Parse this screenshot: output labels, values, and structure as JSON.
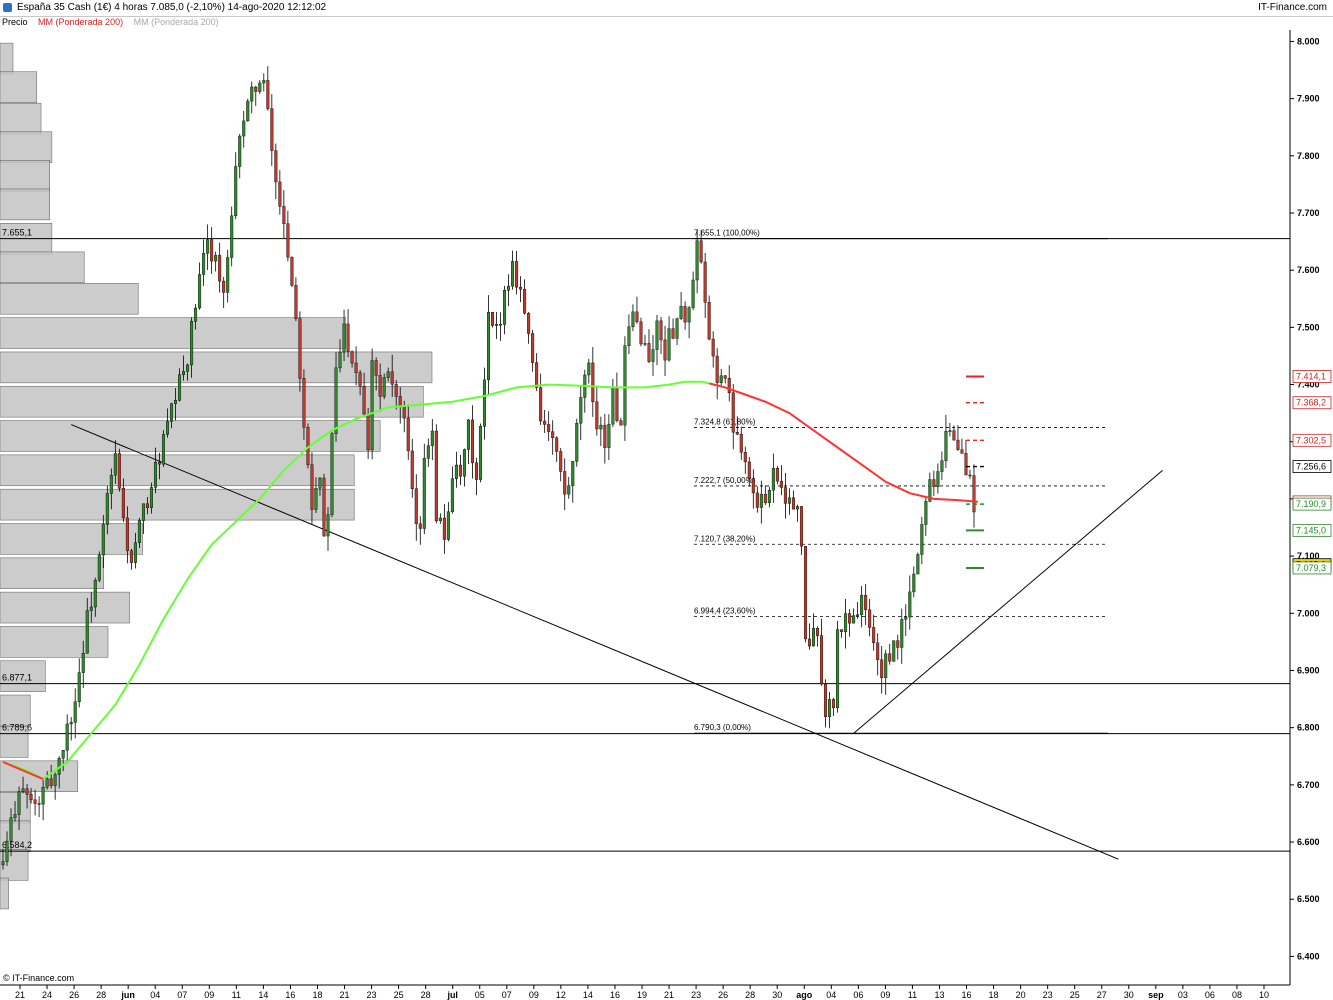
{
  "header": {
    "title": "España 35 Cash (1€)   4 horas   7.085,0 (-2,10%)   14-ago-2020 12:12:02",
    "brand": "IT-Finance.com"
  },
  "legend": {
    "price": "Precio",
    "ma": "MM (Ponderada 200)",
    "extra": "MM (Ponderada 200)"
  },
  "copyright": "© IT-Finance.com",
  "colors": {
    "ma": "#ff3333",
    "ma_green": "#66ff33",
    "up": "#2d8a2d",
    "down": "#c0392b",
    "profile": "#c4c4c4",
    "current": "#f5d000"
  },
  "chart_data": {
    "type": "candlestick",
    "ylim": [
      6350,
      8020
    ],
    "y_ticks": [
      "6.400",
      "6.500",
      "6.600",
      "6.700",
      "6.800",
      "6.900",
      "7.000",
      "7.100",
      "7.200",
      "7.300",
      "7.400",
      "7.500",
      "7.600",
      "7.700",
      "7.800",
      "7.900",
      "8.000"
    ],
    "x_ticks": [
      {
        "label": "21"
      },
      {
        "label": "24"
      },
      {
        "label": "26"
      },
      {
        "label": "28"
      },
      {
        "label": "jun",
        "bold": true
      },
      {
        "label": "04"
      },
      {
        "label": "07"
      },
      {
        "label": "09"
      },
      {
        "label": "11"
      },
      {
        "label": "14"
      },
      {
        "label": "16"
      },
      {
        "label": "18"
      },
      {
        "label": "21"
      },
      {
        "label": "23"
      },
      {
        "label": "25"
      },
      {
        "label": "28"
      },
      {
        "label": "jul",
        "bold": true
      },
      {
        "label": "05"
      },
      {
        "label": "07"
      },
      {
        "label": "09"
      },
      {
        "label": "12"
      },
      {
        "label": "14"
      },
      {
        "label": "16"
      },
      {
        "label": "19"
      },
      {
        "label": "21"
      },
      {
        "label": "23"
      },
      {
        "label": "26"
      },
      {
        "label": "28"
      },
      {
        "label": "30"
      },
      {
        "label": "ago",
        "bold": true
      },
      {
        "label": "04"
      },
      {
        "label": "06"
      },
      {
        "label": "09"
      },
      {
        "label": "11"
      },
      {
        "label": "13"
      },
      {
        "label": "16"
      },
      {
        "label": "18"
      },
      {
        "label": "20"
      },
      {
        "label": "23"
      },
      {
        "label": "25"
      },
      {
        "label": "27"
      },
      {
        "label": "30"
      },
      {
        "label": "sep",
        "bold": true
      },
      {
        "label": "03"
      },
      {
        "label": "06"
      },
      {
        "label": "08"
      },
      {
        "label": "10"
      }
    ],
    "horizontal_levels": [
      {
        "value": 7655.1,
        "label": "7.655,1"
      },
      {
        "value": 6877.1,
        "label": "6.877,1"
      },
      {
        "value": 6789.6,
        "label": "6.789,6"
      },
      {
        "value": 6584.2,
        "label": "6.584,2"
      }
    ],
    "fibonacci": [
      {
        "value": 7655.1,
        "label": "7.655,1 (100,00%)",
        "solid": true
      },
      {
        "value": 7324.8,
        "label": "7.324,8 (61,80%)"
      },
      {
        "value": 7222.7,
        "label": "7.222,7 (50,00%)"
      },
      {
        "value": 7120.7,
        "label": "7.120,7 (38,20%)"
      },
      {
        "value": 6994.4,
        "label": "6.994,4 (23,60%)"
      },
      {
        "value": 6790.3,
        "label": "6.790,3 (0,00%)",
        "solid": true
      }
    ],
    "price_labels": [
      {
        "value": 7414.1,
        "label": "7.414,1",
        "color": "#d22222"
      },
      {
        "value": 7368.2,
        "label": "7.368,2",
        "color": "#d22222"
      },
      {
        "value": 7302.5,
        "label": "7.302,5",
        "color": "#d22222"
      },
      {
        "value": 7256.6,
        "label": "7.256,6",
        "color": "#000000"
      },
      {
        "value": 7194.8,
        "label": "7.194,8",
        "color": "#d22222"
      },
      {
        "value": 7190.9,
        "label": "7.190,9",
        "color": "#2d8a2d"
      },
      {
        "value": 7145.0,
        "label": "7.145,0",
        "color": "#2d8a2d"
      },
      {
        "value": 7085.0,
        "label": "7.085,0",
        "color": "#000000",
        "current": true
      },
      {
        "value": 7079.3,
        "label": "7.079,3",
        "color": "#2d8a2d"
      }
    ],
    "volume_profile": [
      {
        "price": 7970,
        "size": 0.03
      },
      {
        "price": 7920,
        "size": 0.085
      },
      {
        "price": 7865,
        "size": 0.095
      },
      {
        "price": 7815,
        "size": 0.12
      },
      {
        "price": 7765,
        "size": 0.115
      },
      {
        "price": 7715,
        "size": 0.115
      },
      {
        "price": 7655,
        "size": 0.12
      },
      {
        "price": 7605,
        "size": 0.195
      },
      {
        "price": 7550,
        "size": 0.32
      },
      {
        "price": 7490,
        "size": 0.8
      },
      {
        "price": 7430,
        "size": 1.0
      },
      {
        "price": 7370,
        "size": 0.98
      },
      {
        "price": 7310,
        "size": 0.88
      },
      {
        "price": 7250,
        "size": 0.82
      },
      {
        "price": 7190,
        "size": 0.82
      },
      {
        "price": 7130,
        "size": 0.33
      },
      {
        "price": 7070,
        "size": 0.24
      },
      {
        "price": 7010,
        "size": 0.3
      },
      {
        "price": 6950,
        "size": 0.25
      },
      {
        "price": 6890,
        "size": 0.105
      },
      {
        "price": 6830,
        "size": 0.07
      },
      {
        "price": 6775,
        "size": 0.065
      },
      {
        "price": 6715,
        "size": 0.18
      },
      {
        "price": 6660,
        "size": 0.07
      },
      {
        "price": 6610,
        "size": 0.07
      },
      {
        "price": 6560,
        "size": 0.065
      },
      {
        "price": 6510,
        "size": 0.02
      }
    ],
    "price_path": [
      [
        0,
        6560
      ],
      [
        4,
        6700
      ],
      [
        8,
        6660
      ],
      [
        13,
        6720
      ],
      [
        18,
        6850
      ],
      [
        21,
        6990
      ],
      [
        24,
        7090
      ],
      [
        26,
        7200
      ],
      [
        28,
        7270
      ],
      [
        30,
        7160
      ],
      [
        32,
        7080
      ],
      [
        34,
        7150
      ],
      [
        38,
        7250
      ],
      [
        42,
        7350
      ],
      [
        46,
        7450
      ],
      [
        49,
        7580
      ],
      [
        51,
        7650
      ],
      [
        53,
        7620
      ],
      [
        55,
        7550
      ],
      [
        57,
        7680
      ],
      [
        59,
        7850
      ],
      [
        61,
        7880
      ],
      [
        63,
        7930
      ],
      [
        65,
        7920
      ],
      [
        66,
        7870
      ],
      [
        68,
        7750
      ],
      [
        70,
        7690
      ],
      [
        73,
        7520
      ],
      [
        75,
        7340
      ],
      [
        77,
        7200
      ],
      [
        79,
        7250
      ],
      [
        80,
        7120
      ],
      [
        81,
        7180
      ],
      [
        83,
        7420
      ],
      [
        85,
        7500
      ],
      [
        87,
        7450
      ],
      [
        89,
        7410
      ],
      [
        91,
        7300
      ],
      [
        92,
        7450
      ],
      [
        94,
        7390
      ],
      [
        96,
        7440
      ],
      [
        98,
        7380
      ],
      [
        100,
        7330
      ],
      [
        102,
        7200
      ],
      [
        104,
        7130
      ],
      [
        105,
        7280
      ],
      [
        107,
        7330
      ],
      [
        108,
        7180
      ],
      [
        110,
        7130
      ],
      [
        112,
        7250
      ],
      [
        114,
        7230
      ],
      [
        116,
        7320
      ],
      [
        118,
        7230
      ],
      [
        120,
        7400
      ],
      [
        121,
        7510
      ],
      [
        123,
        7490
      ],
      [
        125,
        7560
      ],
      [
        127,
        7610
      ],
      [
        129,
        7570
      ],
      [
        131,
        7480
      ],
      [
        133,
        7400
      ],
      [
        134,
        7350
      ],
      [
        136,
        7310
      ],
      [
        138,
        7280
      ],
      [
        140,
        7200
      ],
      [
        142,
        7250
      ],
      [
        144,
        7380
      ],
      [
        146,
        7420
      ],
      [
        148,
        7340
      ],
      [
        150,
        7300
      ],
      [
        152,
        7380
      ],
      [
        154,
        7320
      ],
      [
        155,
        7450
      ],
      [
        157,
        7520
      ],
      [
        159,
        7490
      ],
      [
        161,
        7440
      ],
      [
        163,
        7500
      ],
      [
        165,
        7460
      ],
      [
        167,
        7500
      ],
      [
        169,
        7530
      ],
      [
        171,
        7520
      ],
      [
        173,
        7640
      ],
      [
        174,
        7600
      ],
      [
        176,
        7470
      ],
      [
        178,
        7420
      ],
      [
        180,
        7410
      ],
      [
        182,
        7330
      ],
      [
        184,
        7300
      ],
      [
        186,
        7240
      ],
      [
        188,
        7180
      ],
      [
        190,
        7210
      ],
      [
        192,
        7250
      ],
      [
        194,
        7230
      ],
      [
        196,
        7190
      ],
      [
        198,
        7180
      ],
      [
        199,
        7100
      ],
      [
        200,
        6970
      ],
      [
        201,
        6930
      ],
      [
        203,
        6980
      ],
      [
        204,
        6870
      ],
      [
        205,
        6830
      ],
      [
        207,
        6840
      ],
      [
        208,
        6960
      ],
      [
        210,
        6990
      ],
      [
        212,
        7000
      ],
      [
        214,
        7020
      ],
      [
        216,
        6980
      ],
      [
        217,
        6940
      ],
      [
        219,
        6900
      ],
      [
        221,
        6920
      ],
      [
        223,
        6950
      ],
      [
        225,
        7000
      ],
      [
        227,
        7060
      ],
      [
        229,
        7160
      ],
      [
        231,
        7230
      ],
      [
        233,
        7250
      ],
      [
        235,
        7320
      ],
      [
        237,
        7310
      ],
      [
        239,
        7270
      ],
      [
        241,
        7230
      ],
      [
        242,
        7190
      ],
      [
        243,
        7085
      ]
    ],
    "ma200": [
      [
        0,
        6740
      ],
      [
        6,
        6725
      ],
      [
        10,
        6710
      ],
      [
        16,
        6740
      ],
      [
        22,
        6790
      ],
      [
        28,
        6840
      ],
      [
        34,
        6910
      ],
      [
        40,
        6990
      ],
      [
        46,
        7060
      ],
      [
        52,
        7120
      ],
      [
        58,
        7160
      ],
      [
        64,
        7200
      ],
      [
        70,
        7250
      ],
      [
        76,
        7290
      ],
      [
        82,
        7320
      ],
      [
        88,
        7340
      ],
      [
        96,
        7360
      ],
      [
        104,
        7365
      ],
      [
        112,
        7370
      ],
      [
        120,
        7380
      ],
      [
        128,
        7395
      ],
      [
        136,
        7400
      ],
      [
        144,
        7398
      ],
      [
        152,
        7395
      ],
      [
        160,
        7395
      ],
      [
        166,
        7400
      ],
      [
        170,
        7405
      ],
      [
        174,
        7405
      ],
      [
        176,
        7402
      ],
      [
        180,
        7395
      ],
      [
        186,
        7380
      ],
      [
        190,
        7370
      ],
      [
        196,
        7350
      ],
      [
        202,
        7320
      ],
      [
        208,
        7290
      ],
      [
        214,
        7260
      ],
      [
        220,
        7230
      ],
      [
        226,
        7210
      ],
      [
        232,
        7200
      ],
      [
        238,
        7198
      ],
      [
        243,
        7195
      ]
    ],
    "ma_green_until": 176,
    "x_count": 243
  }
}
